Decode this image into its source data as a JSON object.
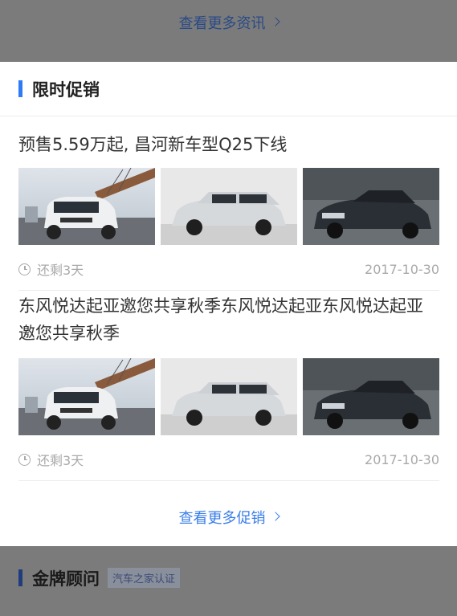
{
  "top": {
    "more_news": "查看更多资讯"
  },
  "section": {
    "title": "限时促销"
  },
  "promos": [
    {
      "title": "预售5.59万起, 昌河新车型Q25下线",
      "images": [
        "bmw-x1-suv-photo",
        "audi-a4-wagon-photo",
        "cadillac-ats-coupe-photo"
      ],
      "remaining": "还剩3天",
      "date": "2017-10-30"
    },
    {
      "title": "东风悦达起亚邀您共享秋季东风悦达起亚东风悦达起亚邀您共享秋季",
      "images": [
        "bmw-x1-suv-photo",
        "audi-a4-wagon-photo",
        "cadillac-ats-coupe-photo"
      ],
      "remaining": "还剩3天",
      "date": "2017-10-30"
    }
  ],
  "more_promos": "查看更多促销",
  "bottom": {
    "title": "金牌顾问",
    "badge": "汽车之家认证"
  },
  "colors": {
    "accent": "#2f7bf5",
    "link": "#3a7ee8",
    "overlay": "#7b7b7b"
  }
}
